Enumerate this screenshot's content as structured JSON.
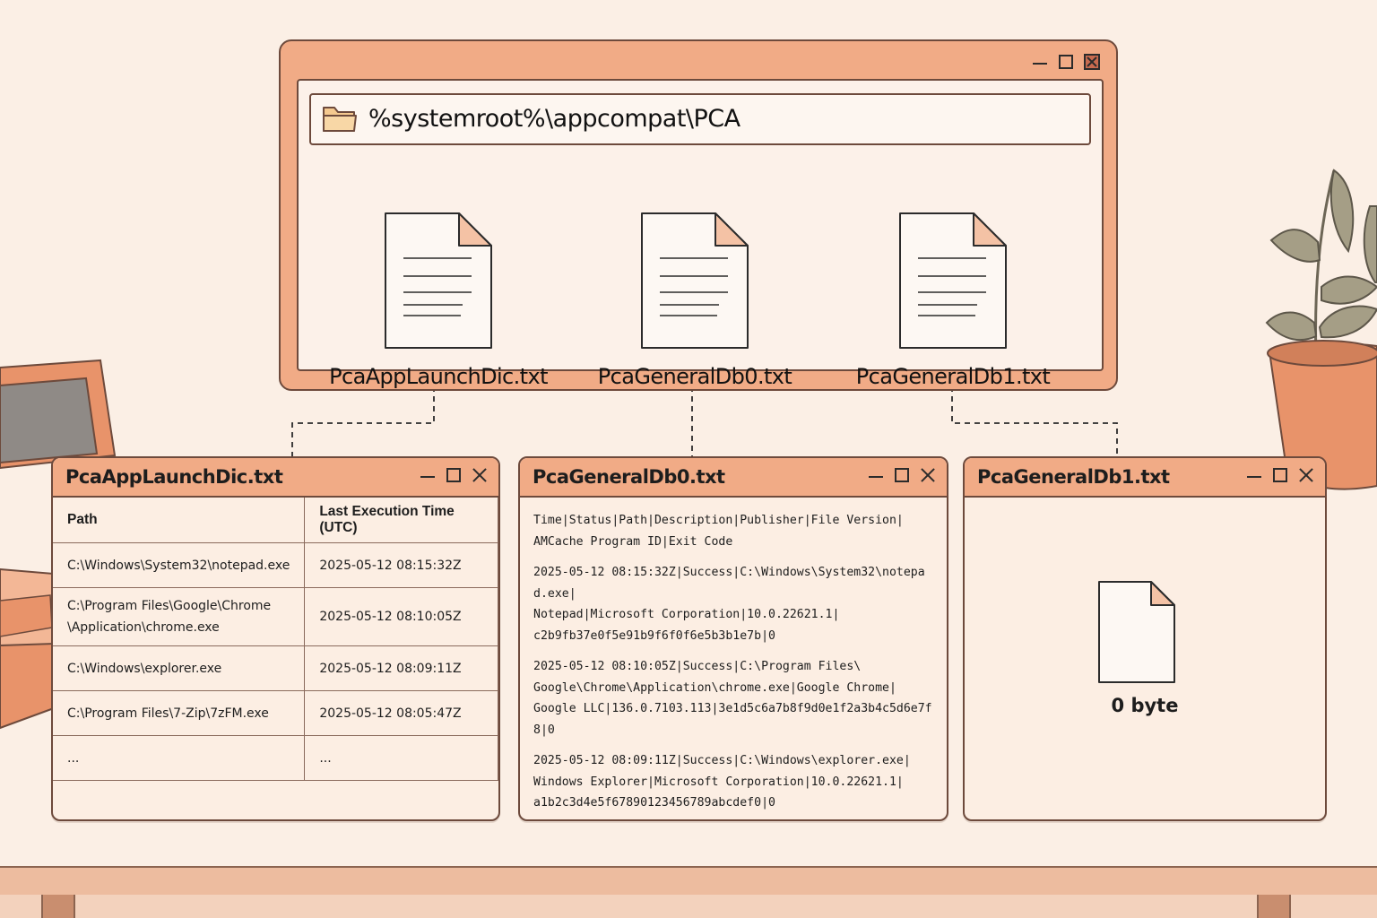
{
  "explorer": {
    "path": "%systemroot%\\appcompat\\PCA",
    "files": [
      {
        "name": "PcaAppLaunchDic.txt"
      },
      {
        "name": "PcaGeneralDb0.txt"
      },
      {
        "name": "PcaGeneralDb1.txt"
      }
    ]
  },
  "launch_dic": {
    "title": "PcaAppLaunchDic.txt",
    "columns": [
      "Path",
      "Last Execution Time (UTC)"
    ],
    "rows": [
      [
        "C:\\Windows\\System32\\notepad.exe",
        "2025-05-12 08:15:32Z"
      ],
      [
        "C:\\Program Files\\Google\\Chrome\n\\Application\\chrome.exe",
        "2025-05-12 08:10:05Z"
      ],
      [
        "C:\\Windows\\explorer.exe",
        "2025-05-12 08:09:11Z"
      ],
      [
        "C:\\Program Files\\7-Zip\\7zFM.exe",
        "2025-05-12 08:05:47Z"
      ],
      [
        "...",
        "..."
      ]
    ]
  },
  "general_db0": {
    "title": "PcaGeneralDb0.txt",
    "header_line": "Time|Status|Path|Description|Publisher|File Version|\nAMCache Program ID|Exit Code",
    "entries": [
      "2025-05-12 08:15:32Z|Success|C:\\Windows\\System32\\notepad.exe|\nNotepad|Microsoft Corporation|10.0.22621.1|\nc2b9fb37e0f5e91b9f6f0f6e5b3b1e7b|0",
      "2025-05-12 08:10:05Z|Success|C:\\Program Files\\\nGoogle\\Chrome\\Application\\chrome.exe|Google Chrome|\nGoogle LLC|136.0.7103.113|3e1d5c6a7b8f9d0e1f2a3b4c5d6e7f8|0",
      "2025-05-12 08:09:11Z|Success|C:\\Windows\\explorer.exe|\nWindows Explorer|Microsoft Corporation|10.0.22621.1|\na1b2c3d4e5f67890123456789abcdef0|0",
      "..."
    ]
  },
  "general_db1": {
    "title": "PcaGeneralDb1.txt",
    "size_label": "0 byte"
  },
  "icons": [
    "folder-icon",
    "document-icon",
    "minimize-icon",
    "maximize-icon",
    "close-icon"
  ],
  "colors": {
    "accent": "#f1ab86",
    "background": "#fbefe5",
    "outline": "#6d4a3c"
  }
}
